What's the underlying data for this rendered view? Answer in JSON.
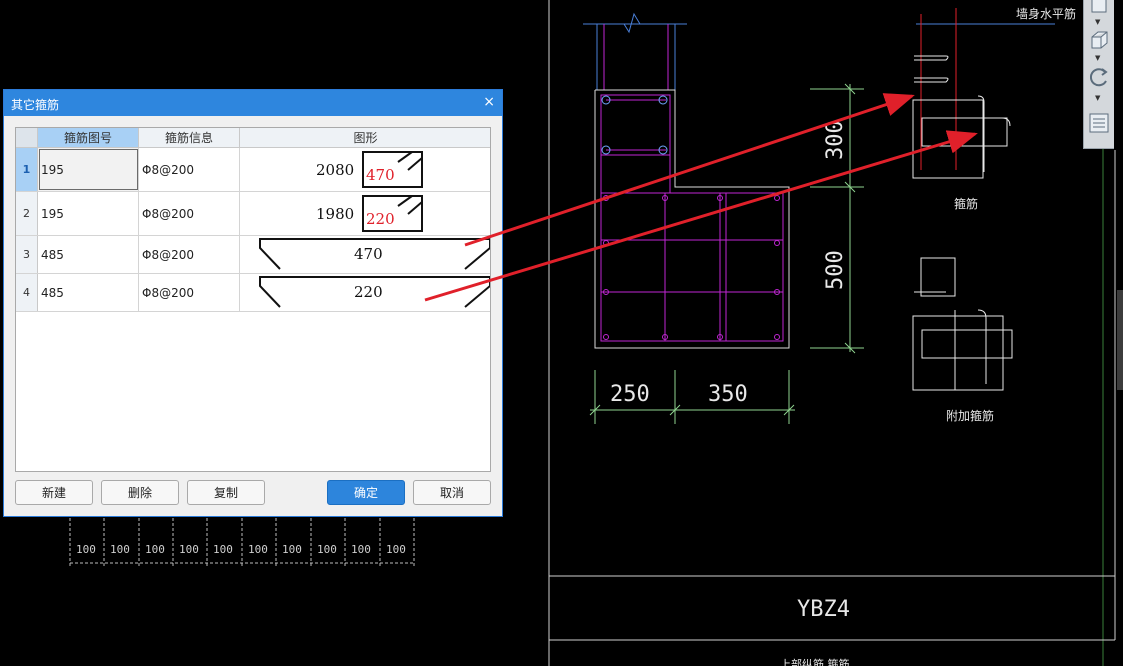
{
  "dialog": {
    "title": "其它箍筋",
    "close": "×",
    "columns": {
      "code": "箍筋图号",
      "info": "箍筋信息",
      "shape": "图形"
    },
    "rows": [
      {
        "no": "1",
        "code": "195",
        "info": "Φ8@200",
        "len_a": "2080",
        "len_b": "470"
      },
      {
        "no": "2",
        "code": "195",
        "info": "Φ8@200",
        "len_a": "1980",
        "len_b": "220"
      },
      {
        "no": "3",
        "code": "485",
        "info": "Φ8@200",
        "len_a": "470"
      },
      {
        "no": "4",
        "code": "485",
        "info": "Φ8@200",
        "len_a": "220"
      }
    ],
    "buttons": {
      "new": "新建",
      "delete": "删除",
      "copy": "复制",
      "ok": "确定",
      "cancel": "取消"
    }
  },
  "cad": {
    "dim_250": "250",
    "dim_350": "350",
    "dim_300": "300",
    "dim_500": "500",
    "label_wall_bar": "墙身水平筋",
    "label_stirrup": "箍筋",
    "label_extra": "附加箍筋",
    "column_id": "YBZ4",
    "spacing_label": "100",
    "bottom_partial": "上部纵筋 箍筋"
  },
  "toolbar": {
    "icons": [
      "cube-front-icon",
      "cube-iso-icon",
      "rotate-icon",
      "grid-icon"
    ]
  },
  "colors": {
    "accent": "#2e86de",
    "magenta": "#c026d3",
    "green": "#8fd48f",
    "blue": "#4a7fd8",
    "red": "#e0202a"
  }
}
